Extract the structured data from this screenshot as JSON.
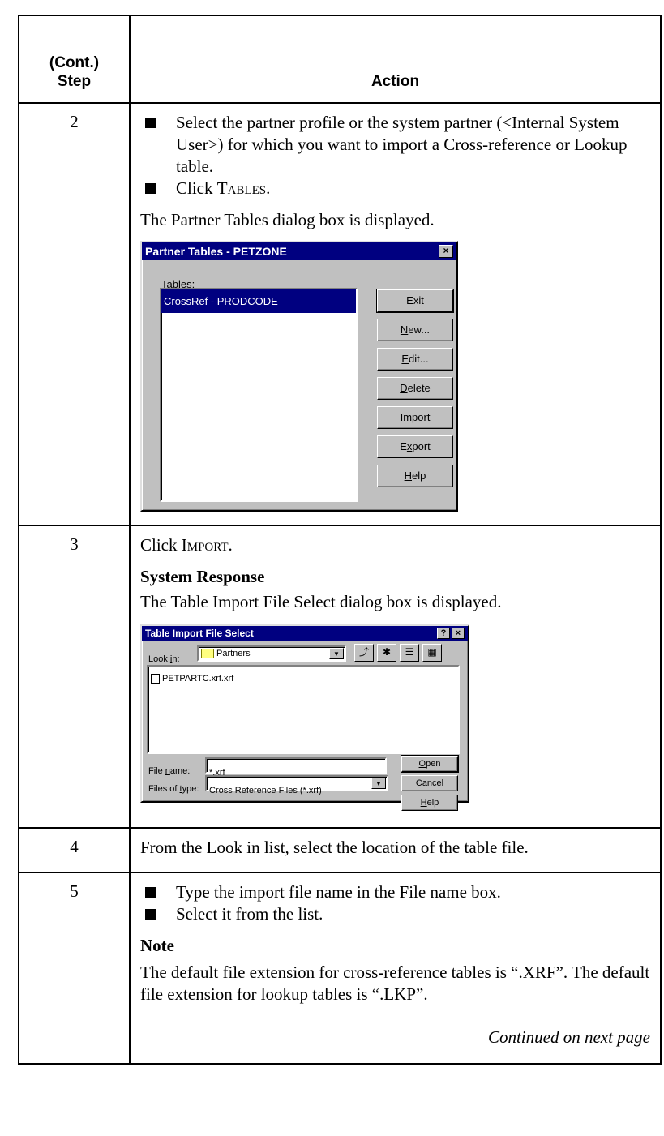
{
  "header": {
    "step_line1": "(Cont.)",
    "step_line2": "Step",
    "action": "Action"
  },
  "rows": [
    {
      "step": "2",
      "bullet1": "Select the partner profile or the system partner (<Internal System User>) for which you want to import a Cross-reference or Lookup table.",
      "bullet2_prefix": "Click ",
      "bullet2_sc": "Tables",
      "bullet2_suffix": ".",
      "para": "The Partner Tables dialog box is displayed."
    },
    {
      "step": "3",
      "line_prefix": "Click ",
      "line_sc": "Import",
      "line_suffix": ".",
      "heading": "System Response",
      "para": "The Table Import File Select dialog box is displayed."
    },
    {
      "step": "4",
      "text": "From the Look in list, select the location of the table file."
    },
    {
      "step": "5",
      "bullet1": "Type the import file name in the File name box.",
      "bullet2": "Select it from the list.",
      "note_heading": "Note",
      "note": "The default file extension for cross-reference tables is “.XRF”. The default file extension for lookup tables is “.LKP”.",
      "continued": "Continued on next page"
    }
  ],
  "dialog1": {
    "title": "Partner Tables - PETZONE",
    "close": "×",
    "tables_label_u": "T",
    "tables_label_rest": "ables:",
    "items": [
      "CrossRef - PRODCODE"
    ],
    "buttons": {
      "exit": "Exit",
      "new_u": "N",
      "new_rest": "ew...",
      "edit_u": "E",
      "edit_rest": "dit...",
      "delete_u": "D",
      "delete_rest": "elete",
      "import_pre": "I",
      "import_u": "m",
      "import_rest": "port",
      "export_pre": "E",
      "export_u": "x",
      "export_rest": "port",
      "help_u": "H",
      "help_rest": "elp"
    }
  },
  "dialog2": {
    "title": "Table Import File Select",
    "help": "?",
    "close": "×",
    "lookin_pre": "Look ",
    "lookin_u": "i",
    "lookin_rest": "n:",
    "lookin_value": "Partners",
    "files": [
      "PETPARTC.xrf.xrf"
    ],
    "filename_pre": "File ",
    "filename_u": "n",
    "filename_rest": "ame:",
    "filename_value": "*.xrf",
    "filetype_pre": "Files of ",
    "filetype_u": "t",
    "filetype_rest": "ype:",
    "filetype_value": "Cross Reference Files (*.xrf)",
    "open_u": "O",
    "open_rest": "pen",
    "cancel": "Cancel",
    "help_u": "H",
    "help_rest": "elp"
  }
}
